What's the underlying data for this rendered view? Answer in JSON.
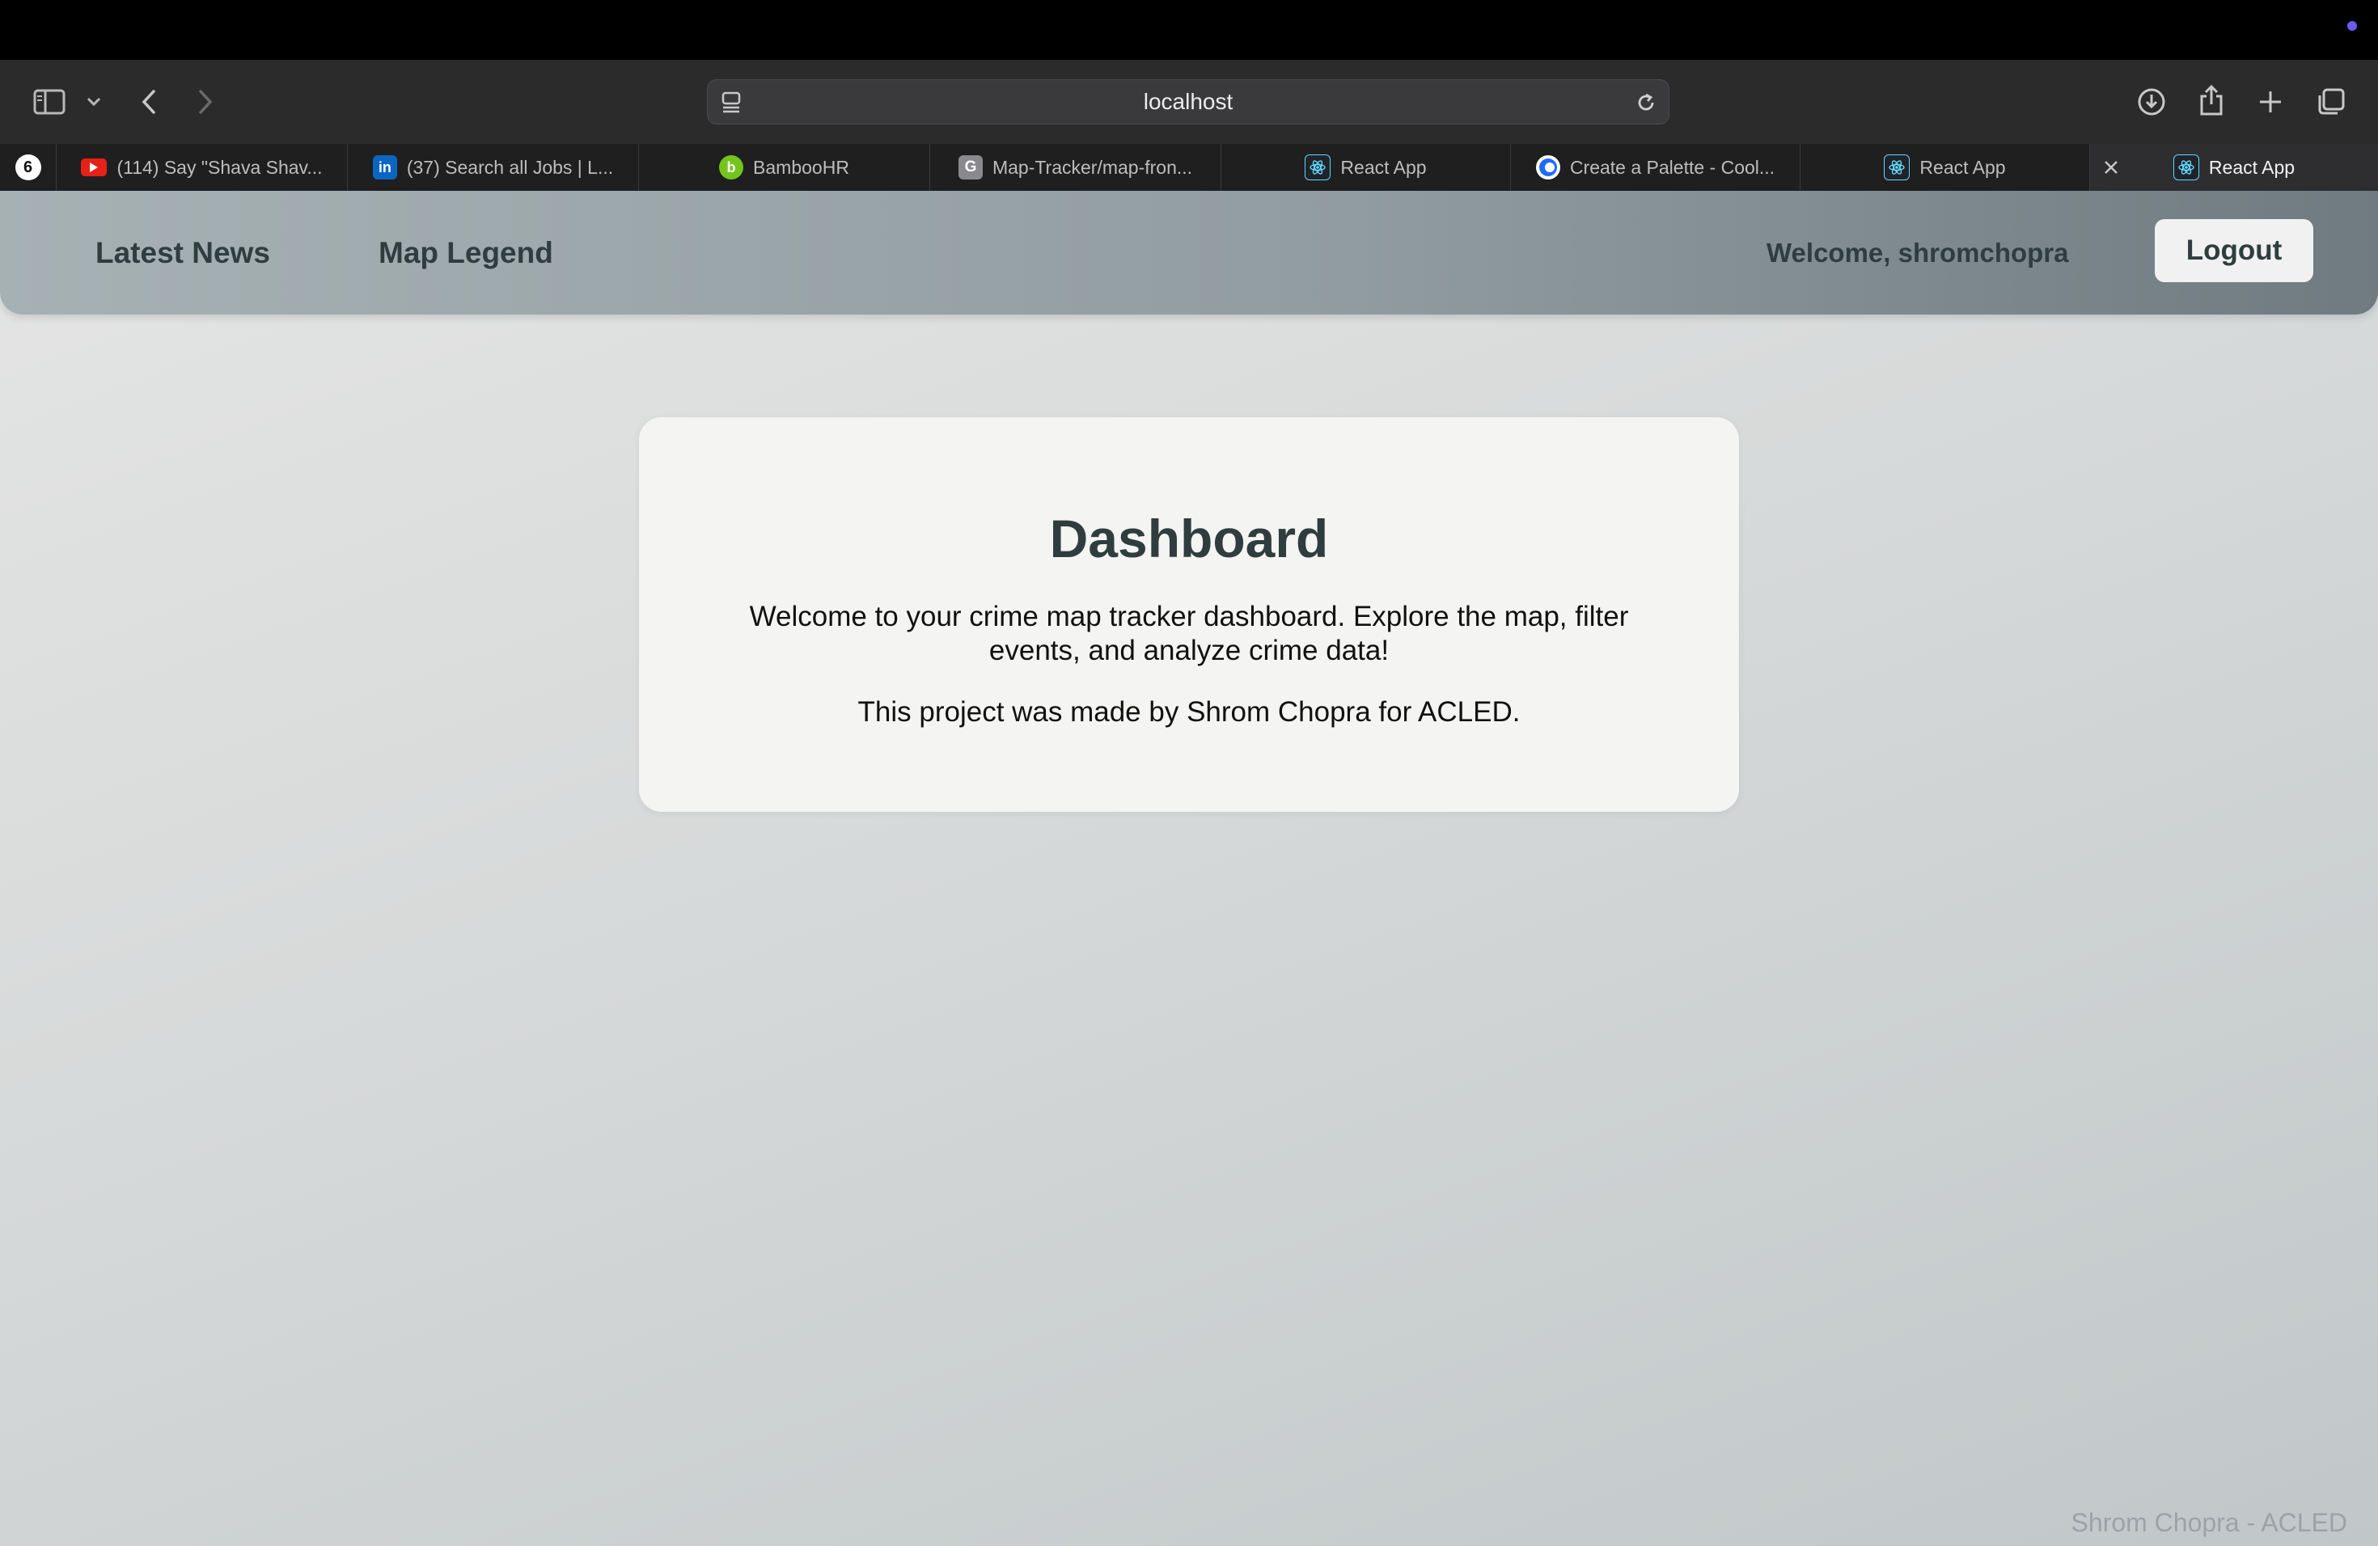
{
  "browser": {
    "url": "localhost",
    "tabs": [
      {
        "title": "(114) Say \"Shava Shav...",
        "favicon": "youtube-icon",
        "color": "#e62117"
      },
      {
        "title": "(37) Search all Jobs | L...",
        "favicon": "linkedin-icon",
        "color": "#0a66c2"
      },
      {
        "title": "BambooHR",
        "favicon": "bamboohr-icon",
        "color": "#73c41d"
      },
      {
        "title": "Map-Tracker/map-fron...",
        "favicon": "github-g-icon",
        "color": "#8a8a8e"
      },
      {
        "title": "React App",
        "favicon": "react-icon",
        "color": "#61dafb"
      },
      {
        "title": "Create a Palette - Cool...",
        "favicon": "coolors-icon",
        "color": "#1e6bff"
      },
      {
        "title": "React App",
        "favicon": "react-icon",
        "color": "#61dafb"
      },
      {
        "title": "React App",
        "favicon": "react-icon",
        "color": "#61dafb",
        "active": true
      }
    ]
  },
  "nav": {
    "latest_news": "Latest News",
    "map_legend": "Map Legend",
    "welcome": "Welcome, shromchopra",
    "logout": "Logout"
  },
  "card": {
    "title": "Dashboard",
    "intro": "Welcome to your crime map tracker dashboard. Explore the map, filter events, and analyze crime data!",
    "credit": "This project was made by Shrom Chopra for ACLED."
  },
  "footer": {
    "text": "Shrom Chopra - ACLED"
  }
}
